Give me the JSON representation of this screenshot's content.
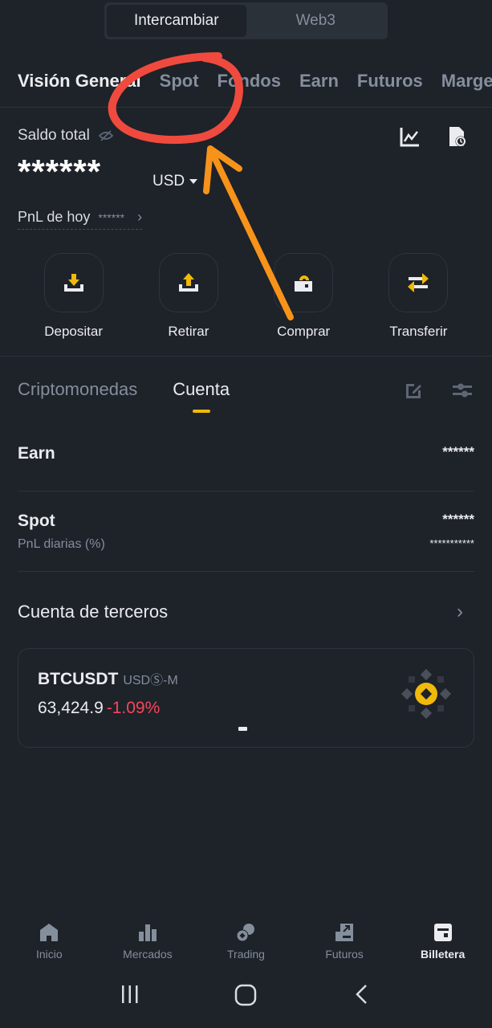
{
  "top_switch": {
    "items": [
      "Intercambiar",
      "Web3"
    ],
    "active": 0
  },
  "category_tabs": [
    "Visión General",
    "Spot",
    "Fondos",
    "Earn",
    "Futuros",
    "Margen"
  ],
  "balance": {
    "label": "Saldo total",
    "value_masked": "******",
    "currency": "USD",
    "pnl_label": "PnL de hoy",
    "pnl_value_masked": "******"
  },
  "actions": [
    {
      "label": "Depositar",
      "icon": "deposit-icon"
    },
    {
      "label": "Retirar",
      "icon": "withdraw-icon"
    },
    {
      "label": "Comprar",
      "icon": "buy-icon"
    },
    {
      "label": "Transferir",
      "icon": "transfer-icon"
    }
  ],
  "sub_tabs": {
    "items": [
      "Criptomonedas",
      "Cuenta"
    ],
    "active": 1
  },
  "accounts": {
    "earn": {
      "title": "Earn",
      "value": "******"
    },
    "spot": {
      "title": "Spot",
      "value": "******",
      "sub_label": "PnL diarias (%)",
      "sub_value": "***********"
    },
    "third_party": {
      "title": "Cuenta de terceros"
    }
  },
  "ticker_card": {
    "symbol": "BTCUSDT",
    "market": "USDⓈ-M",
    "price": "63,424.9",
    "change": "-1.09%"
  },
  "bottom_nav": {
    "items": [
      "Inicio",
      "Mercados",
      "Trading",
      "Futuros",
      "Billetera"
    ],
    "active": 4
  },
  "colors": {
    "background": "#1e2229",
    "accent": "#f0b90b",
    "negative": "#f6465d",
    "muted": "#848e9c",
    "annotation_red": "#f04a3e",
    "annotation_orange": "#f7931a"
  }
}
